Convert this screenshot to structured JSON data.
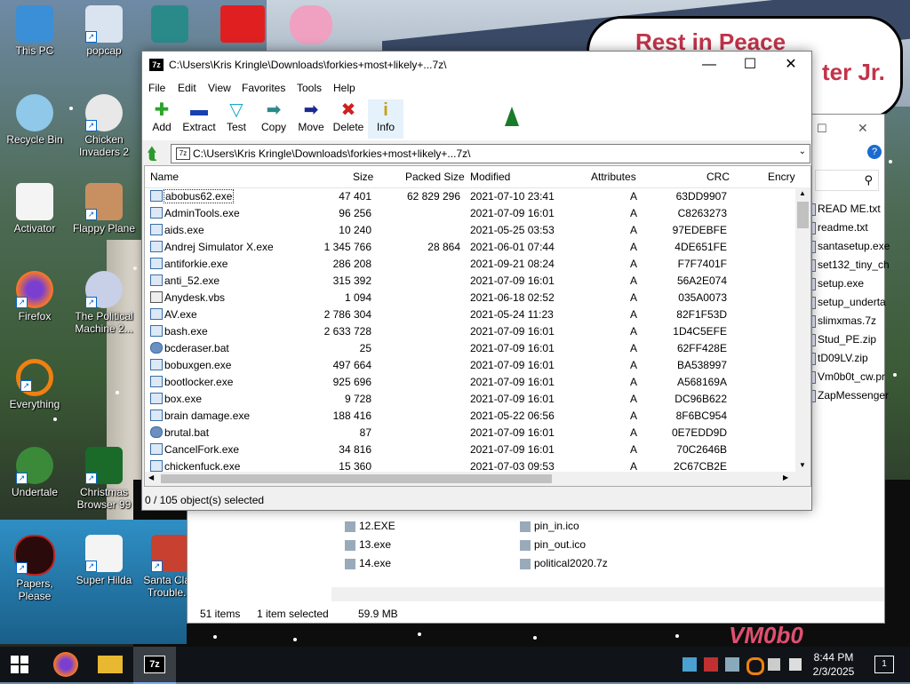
{
  "desktop": {
    "icons": [
      {
        "label": "This PC"
      },
      {
        "label": "popcap"
      },
      {
        "label": "Recycle Bin"
      },
      {
        "label": "Chicken Invaders 2"
      },
      {
        "label": "Activator"
      },
      {
        "label": "Flappy Plane"
      },
      {
        "label": "Firefox"
      },
      {
        "label": "The Political Machine 2..."
      },
      {
        "label": "Everything"
      },
      {
        "label": "Undertale"
      },
      {
        "label": "Christmas Browser 99"
      },
      {
        "label": "Papers, Please"
      },
      {
        "label": "Super Hilda"
      },
      {
        "label": "Santa Clau Trouble..."
      }
    ],
    "banner_line1": "Rest in Peace",
    "banner_line2": "ter Jr.",
    "corner_logo": "VM0b0"
  },
  "back_explorer": {
    "right_files": [
      "READ ME.txt",
      "readme.txt",
      "santasetup.exe",
      "set132_tiny_ch",
      "setup.exe",
      "setup_underta",
      "slimxmas.7z",
      "Stud_PE.zip",
      "tD09LV.zip",
      "Vm0b0t_cw.pr",
      "ZapMessenger"
    ],
    "lower_files_left": [
      "11.exe",
      "12.EXE",
      "13.exe",
      "14.exe"
    ],
    "lower_files_right": [
      "pumbish",
      "pin_in.ico",
      "pin_out.ico",
      "political2020.7z"
    ],
    "status_items": "51 items",
    "status_selected": "1 item selected",
    "status_size": "59.9 MB",
    "close_glyph": "✕",
    "restore_glyph": "☐",
    "help_glyph": "?",
    "search_glyph": "⚲"
  },
  "window": {
    "title": "C:\\Users\\Kris Kringle\\Downloads\\forkies+most+likely+...7z\\",
    "app_icon": "7z",
    "menu": [
      "File",
      "Edit",
      "View",
      "Favorites",
      "Tools",
      "Help"
    ],
    "toolbar": [
      {
        "label": "Add",
        "icon": "plus-icon",
        "glyph": "✚",
        "color": "#2aa52a"
      },
      {
        "label": "Extract",
        "icon": "minus-icon",
        "glyph": "▬",
        "color": "#1a3fb0"
      },
      {
        "label": "Test",
        "icon": "check-icon",
        "glyph": "▽",
        "color": "#1aa8c8"
      },
      {
        "label": "Copy",
        "icon": "copy-arrow-icon",
        "glyph": "➡",
        "color": "#2a8a8a"
      },
      {
        "label": "Move",
        "icon": "move-arrow-icon",
        "glyph": "➡",
        "color": "#1a2a90"
      },
      {
        "label": "Delete",
        "icon": "delete-x-icon",
        "glyph": "✖",
        "color": "#d02020"
      },
      {
        "label": "Info",
        "icon": "info-icon",
        "glyph": "i",
        "color": "#c8a010"
      }
    ],
    "address": "C:\\Users\\Kris Kringle\\Downloads\\forkies+most+likely+...7z\\",
    "columns": {
      "name": "Name",
      "size": "Size",
      "packed": "Packed Size",
      "modified": "Modified",
      "attributes": "Attributes",
      "crc": "CRC",
      "encrypted": "Encry"
    },
    "rows": [
      {
        "name": "abobus62.exe",
        "size": "47 401",
        "packed": "62 829 296",
        "modified": "2021-07-10 23:41",
        "attr": "A",
        "crc": "63DD9907",
        "kind": "exe"
      },
      {
        "name": "AdminTools.exe",
        "size": "96 256",
        "packed": "",
        "modified": "2021-07-09 16:01",
        "attr": "A",
        "crc": "C8263273",
        "kind": "exe"
      },
      {
        "name": "aids.exe",
        "size": "10 240",
        "packed": "",
        "modified": "2021-05-25 03:53",
        "attr": "A",
        "crc": "97EDEBFE",
        "kind": "exe"
      },
      {
        "name": "Andrej Simulator X.exe",
        "size": "1 345 766",
        "packed": "28 864",
        "modified": "2021-06-01 07:44",
        "attr": "A",
        "crc": "4DE651FE",
        "kind": "exe"
      },
      {
        "name": "antiforkie.exe",
        "size": "286 208",
        "packed": "",
        "modified": "2021-09-21 08:24",
        "attr": "A",
        "crc": "F7F7401F",
        "kind": "exe"
      },
      {
        "name": "anti_52.exe",
        "size": "315 392",
        "packed": "",
        "modified": "2021-07-09 16:01",
        "attr": "A",
        "crc": "56A2E074",
        "kind": "exe"
      },
      {
        "name": "Anydesk.vbs",
        "size": "1 094",
        "packed": "",
        "modified": "2021-06-18 02:52",
        "attr": "A",
        "crc": "035A0073",
        "kind": "vbs"
      },
      {
        "name": "AV.exe",
        "size": "2 786 304",
        "packed": "",
        "modified": "2021-05-24 11:23",
        "attr": "A",
        "crc": "82F1F53D",
        "kind": "exe"
      },
      {
        "name": "bash.exe",
        "size": "2 633 728",
        "packed": "",
        "modified": "2021-07-09 16:01",
        "attr": "A",
        "crc": "1D4C5EFE",
        "kind": "exe"
      },
      {
        "name": "bcderaser.bat",
        "size": "25",
        "packed": "",
        "modified": "2021-07-09 16:01",
        "attr": "A",
        "crc": "62FF428E",
        "kind": "bat"
      },
      {
        "name": "bobuxgen.exe",
        "size": "497 664",
        "packed": "",
        "modified": "2021-07-09 16:01",
        "attr": "A",
        "crc": "BA538997",
        "kind": "exe"
      },
      {
        "name": "bootlocker.exe",
        "size": "925 696",
        "packed": "",
        "modified": "2021-07-09 16:01",
        "attr": "A",
        "crc": "A568169A",
        "kind": "exe"
      },
      {
        "name": "box.exe",
        "size": "9 728",
        "packed": "",
        "modified": "2021-07-09 16:01",
        "attr": "A",
        "crc": "DC96B622",
        "kind": "exe"
      },
      {
        "name": "brain damage.exe",
        "size": "188 416",
        "packed": "",
        "modified": "2021-05-22 06:56",
        "attr": "A",
        "crc": "8F6BC954",
        "kind": "exe"
      },
      {
        "name": "brutal.bat",
        "size": "87",
        "packed": "",
        "modified": "2021-07-09 16:01",
        "attr": "A",
        "crc": "0E7EDD9D",
        "kind": "bat"
      },
      {
        "name": "CancelFork.exe",
        "size": "34 816",
        "packed": "",
        "modified": "2021-07-09 16:01",
        "attr": "A",
        "crc": "70C2646B",
        "kind": "exe"
      },
      {
        "name": "chickenfuck.exe",
        "size": "15 360",
        "packed": "",
        "modified": "2021-07-03 09:53",
        "attr": "A",
        "crc": "2C67CB2E",
        "kind": "exe"
      }
    ],
    "status": "0 / 105 object(s) selected",
    "minimize_glyph": "—",
    "maximize_glyph": "☐",
    "close_glyph": "✕",
    "up_glyph": "⮬",
    "dropdown_glyph": "⌄",
    "scroll_up": "▲",
    "scroll_down": "▼",
    "scroll_left": "◀",
    "scroll_right": "▶"
  },
  "taskbar": {
    "time": "8:44 PM",
    "date": "2/3/2025",
    "pinned_7z": "7z",
    "notification_count": "1"
  }
}
